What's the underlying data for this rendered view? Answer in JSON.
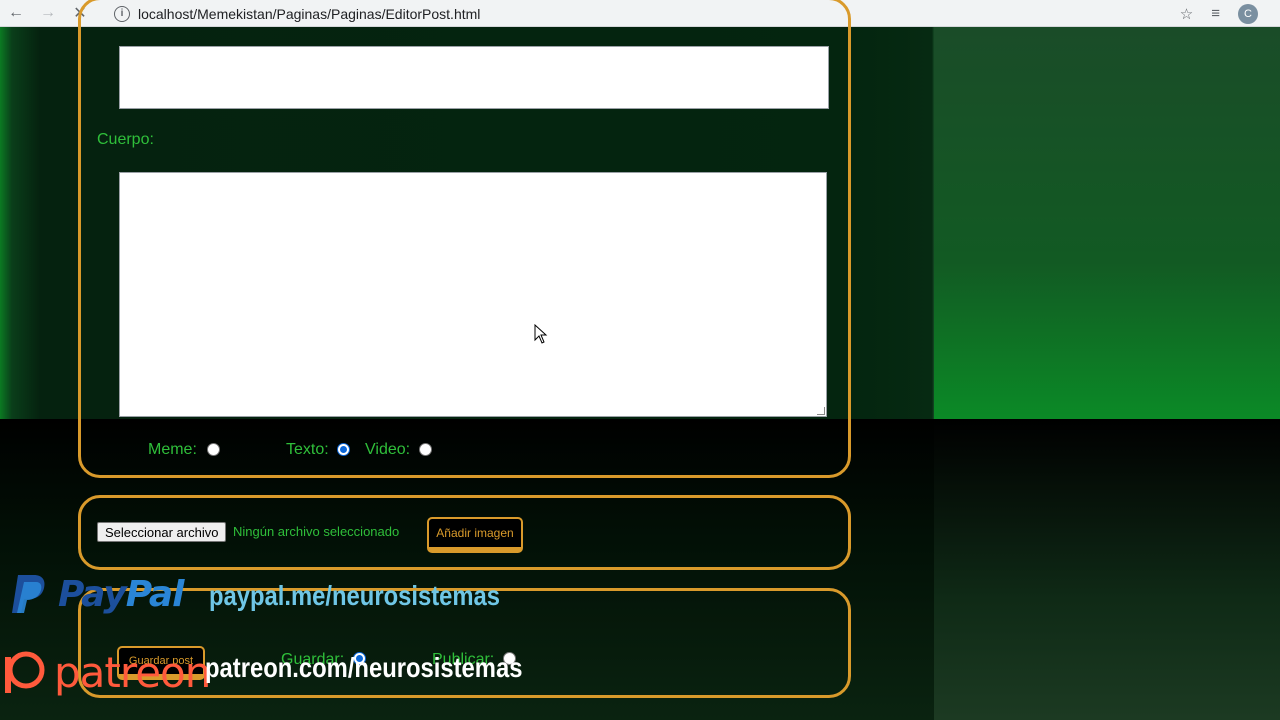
{
  "browser": {
    "url": "localhost/Memekistan/Paginas/Paginas/EditorPost.html",
    "avatar_letter": "C",
    "icons": [
      "back-arrow-icon",
      "forward-arrow-icon",
      "stop-loading-icon",
      "info-icon",
      "star-icon",
      "media-queue-icon"
    ]
  },
  "form": {
    "body_label": "Cuerpo:",
    "title_value": "",
    "body_value": "",
    "type_options": [
      {
        "label": "Meme:",
        "checked": false
      },
      {
        "label": "Texto:",
        "checked": true
      },
      {
        "label": "Video:",
        "checked": false
      }
    ]
  },
  "upload": {
    "choose_label": "Seleccionar archivo",
    "status": "Ningún archivo seleccionado",
    "add_image_label": "Añadir imagen"
  },
  "save": {
    "save_post_label": "Guardar post",
    "options": [
      {
        "label": "Guardar:",
        "checked": true
      },
      {
        "label": "Publicar:",
        "checked": false
      }
    ]
  },
  "watermark": {
    "paypal_logo_a": "Pay",
    "paypal_logo_b": "Pal",
    "paypal_url": "paypal.me/neurosistemas",
    "patreon_logo": "patreon",
    "patreon_url": "patreon.com/neurosistemas"
  },
  "colors": {
    "accent_border": "#d99a2b",
    "label_green": "#2fbf3a",
    "radio_checked": "#0a66d8"
  }
}
